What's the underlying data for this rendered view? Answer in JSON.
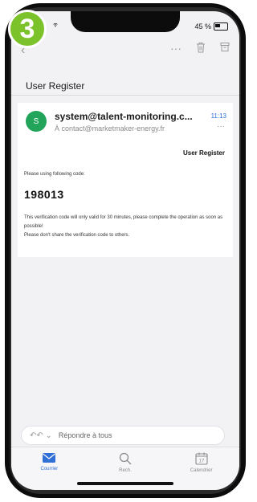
{
  "step_badge": "3",
  "status_bar": {
    "battery": "45 %"
  },
  "toolbar": {
    "more": "···"
  },
  "email": {
    "subject": "User Register",
    "avatar_initial": "S",
    "sender": "system@talent-monitoring.c...",
    "time": "11:13",
    "to": "À contact@marketmaker-energy.fr",
    "body_title": "User Register",
    "greeting": "Please using following code:",
    "code": "198013",
    "paragraph": "This verification code will only valid for 30 minutes, please complete the operation as soon as possible!",
    "note": "Please don't share the verification code to others."
  },
  "reply_bar": {
    "placeholder": "Répondre à tous"
  },
  "tabs": [
    {
      "label": "Courrier",
      "active": true
    },
    {
      "label": "Rech.",
      "active": false
    },
    {
      "label": "Calendrier",
      "active": false
    }
  ],
  "colors": {
    "accent": "#2f6fd6",
    "badge": "#7cc32b",
    "avatar": "#22a45a"
  }
}
